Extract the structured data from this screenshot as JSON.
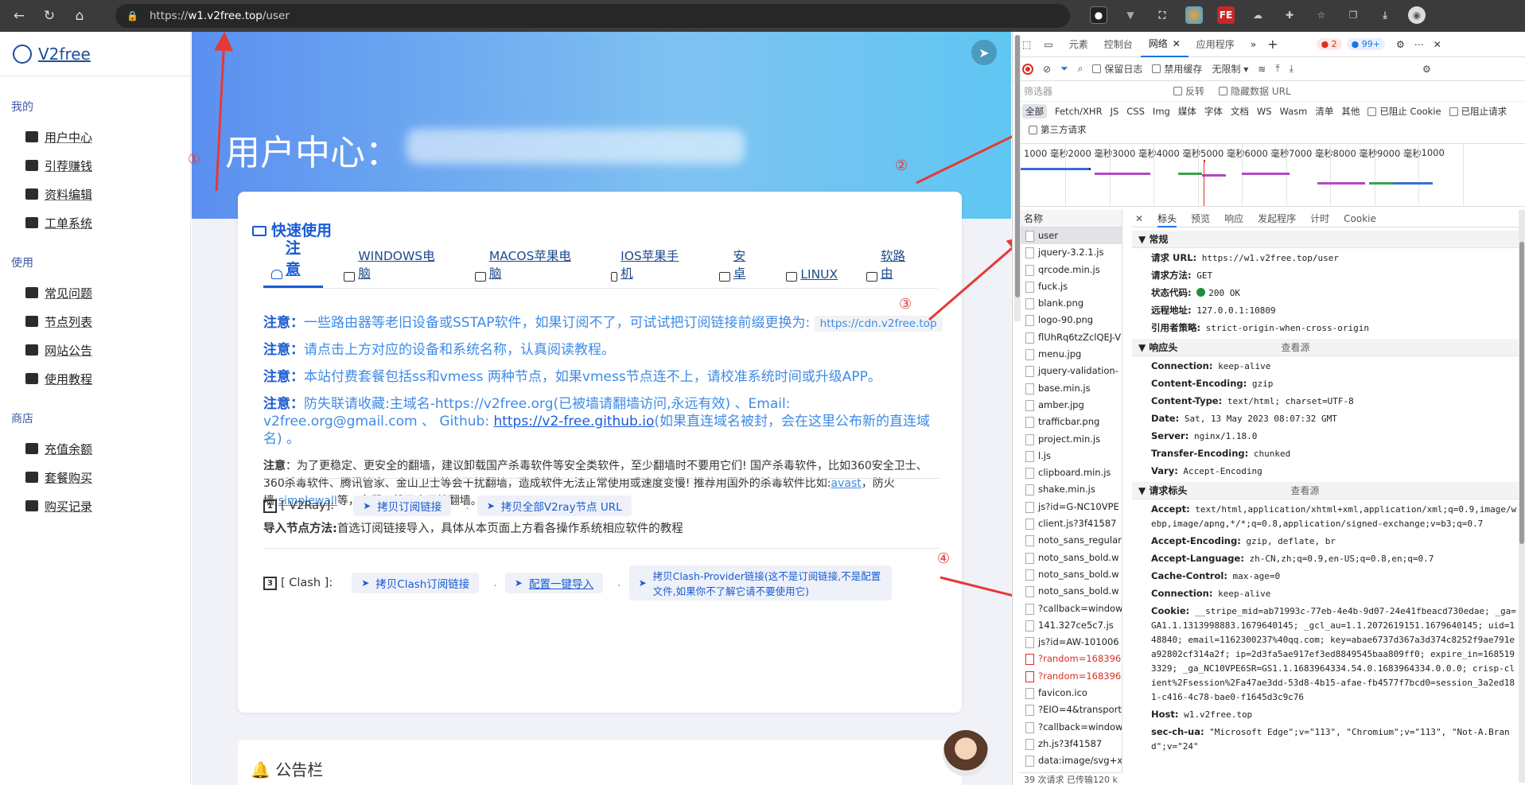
{
  "browser": {
    "url_prefix": "https://",
    "url_host": "w1.v2free.top",
    "url_path": "/user",
    "back_icon": "arrow-left-icon",
    "refresh_icon": "refresh-icon",
    "home_icon": "home-icon"
  },
  "sidebar": {
    "brand": "V2free",
    "sections": [
      {
        "title": "我的",
        "items": [
          "用户中心",
          "引荐赚钱",
          "资料编辑",
          "工单系统"
        ]
      },
      {
        "title": "使用",
        "items": [
          "常见问题",
          "节点列表",
          "网站公告",
          "使用教程"
        ]
      },
      {
        "title": "商店",
        "items": [
          "充值余额",
          "套餐购买",
          "购买记录"
        ]
      }
    ]
  },
  "hero": {
    "title": "用户中心："
  },
  "quick": {
    "title": "快速使用",
    "tabs": [
      "注意",
      "WINDOWS电脑",
      "MACOS苹果电脑",
      "IOS苹果手机",
      "安卓",
      "LINUX",
      "软路由"
    ],
    "note1_label": "注意：",
    "note1_text": "一些路由器等老旧设备或SSTAP软件，如果订阅不了，可试试把订阅链接前缀更换为:",
    "note1_chip": "https://cdn.v2free.top",
    "note2_label": "注意：",
    "note2_text": "请点击上方对应的设备和系统名称，认真阅读教程。",
    "note3_label": "注意：",
    "note3_text": "本站付费套餐包括ss和vmess 两种节点，如果vmess节点连不上，请校准系统时间或升级APP。",
    "note4_label": "注意：",
    "note4_text": "防失联请收藏:主域名-https://v2free.org(已被墙请翻墙访问,永远有效) 、Email: v2free.org@gmail.com 、 Github: ",
    "note4_link": "https://v2-free.github.io",
    "note4_tail": "(如果直连域名被封，会在这里公布新的直连域名) 。",
    "note5_label": "注意",
    "note5_text": "：为了更稳定、更安全的翻墙，建议卸载国产杀毒软件等安全类软件，至少翻墙时不要用它们! 国产杀毒软件，比如360安全卫士、360杀毒软件、腾讯管家、金山卫士等会干扰翻墙，造成软件无法正常使用或速度变慢! 推荐用国外的杀毒软件比如:",
    "note5_link1": "avast",
    "note5_mid": "，防火墙:",
    "note5_link2": "simplewall",
    "note5_tail": "等，它们一般不会干扰翻墙。",
    "v2ray_label": "[ V2Ray]:",
    "v2ray_btn1": "拷贝订阅链接",
    "v2ray_btn2": "拷贝全部V2ray节点 URL",
    "import_label": "导入节点方法:",
    "import_text": "首选订阅链接导入，具体从本页面上方看各操作系统相应软件的教程",
    "clash_label": "[ Clash ]:",
    "clash_btn1": "拷贝Clash订阅链接",
    "clash_btn2": "配置一键导入",
    "clash_btn3": "拷贝Clash-Provider链接(这不是订阅链接,不是配置文件,如果你不了解它请不要使用它)",
    "num1": "1",
    "num3": "3",
    "dot": "."
  },
  "notice": {
    "title": "公告栏"
  },
  "annotations": [
    "①",
    "②",
    "③",
    "④"
  ],
  "devtools": {
    "tabs": [
      "元素",
      "控制台",
      "网络",
      "应用程序"
    ],
    "errors": "2",
    "messages": "99+",
    "toolbar": {
      "preserve_log": "保留日志",
      "disable_cache": "禁用缓存",
      "throttle": "无限制"
    },
    "filter": {
      "placeholder": "筛选器",
      "invert": "反转",
      "hide_data": "隐藏数据 URL"
    },
    "types": [
      "全部",
      "Fetch/XHR",
      "JS",
      "CSS",
      "Img",
      "媒体",
      "字体",
      "文档",
      "WS",
      "Wasm",
      "清单",
      "其他"
    ],
    "blocked_cookies": "已阻止 Cookie",
    "blocked_requests": "已阻止请求",
    "third_party": "第三方请求",
    "timeline_labels": [
      "1000 毫秒",
      "2000 毫秒",
      "3000 毫秒",
      "4000 毫秒",
      "5000 毫秒",
      "6000 毫秒",
      "7000 毫秒",
      "8000 毫秒",
      "9000 毫秒",
      "1000"
    ],
    "name_header": "名称",
    "requests": [
      {
        "name": "user",
        "state": "sel"
      },
      {
        "name": "jquery-3.2.1.js",
        "state": ""
      },
      {
        "name": "qrcode.min.js",
        "state": ""
      },
      {
        "name": "fuck.js",
        "state": ""
      },
      {
        "name": "blank.png",
        "state": ""
      },
      {
        "name": "logo-90.png",
        "state": ""
      },
      {
        "name": "flUhRq6tzZclQEJ-V",
        "state": ""
      },
      {
        "name": "menu.jpg",
        "state": ""
      },
      {
        "name": "jquery-validation-",
        "state": ""
      },
      {
        "name": "base.min.js",
        "state": ""
      },
      {
        "name": "amber.jpg",
        "state": ""
      },
      {
        "name": "trafficbar.png",
        "state": ""
      },
      {
        "name": "project.min.js",
        "state": ""
      },
      {
        "name": "l.js",
        "state": ""
      },
      {
        "name": "clipboard.min.js",
        "state": ""
      },
      {
        "name": "shake.min.js",
        "state": ""
      },
      {
        "name": "js?id=G-NC10VPE",
        "state": ""
      },
      {
        "name": "client.js?3f41587",
        "state": ""
      },
      {
        "name": "noto_sans_regular",
        "state": ""
      },
      {
        "name": "noto_sans_bold.w",
        "state": ""
      },
      {
        "name": "noto_sans_bold.w",
        "state": ""
      },
      {
        "name": "noto_sans_bold.w",
        "state": ""
      },
      {
        "name": "?callback=window",
        "state": ""
      },
      {
        "name": "141.327ce5c7.js",
        "state": ""
      },
      {
        "name": "js?id=AW-101006",
        "state": ""
      },
      {
        "name": "?random=168396",
        "state": "err"
      },
      {
        "name": "?random=168396",
        "state": "err"
      },
      {
        "name": "favicon.ico",
        "state": ""
      },
      {
        "name": "?EIO=4&transport",
        "state": ""
      },
      {
        "name": "?callback=window",
        "state": ""
      },
      {
        "name": "zh.js?3f41587",
        "state": ""
      },
      {
        "name": "data:image/svg+x",
        "state": ""
      }
    ],
    "footer": "39 次请求  已传输120 k",
    "detail_tabs": [
      "标头",
      "预览",
      "响应",
      "发起程序",
      "计时",
      "Cookie"
    ],
    "general": {
      "title": "常规",
      "url_k": "请求 URL:",
      "url_v": "https://w1.v2free.top/user",
      "method_k": "请求方法:",
      "method_v": "GET",
      "status_k": "状态代码:",
      "status_v": "200 OK",
      "remote_k": "远程地址:",
      "remote_v": "127.0.0.1:10809",
      "referrer_k": "引用者策略:",
      "referrer_v": "strict-origin-when-cross-origin"
    },
    "resp": {
      "title": "响应头",
      "view_source": "查看源",
      "h": [
        [
          "Connection:",
          "keep-alive"
        ],
        [
          "Content-Encoding:",
          "gzip"
        ],
        [
          "Content-Type:",
          "text/html; charset=UTF-8"
        ],
        [
          "Date:",
          "Sat, 13 May 2023 08:07:32 GMT"
        ],
        [
          "Server:",
          "nginx/1.18.0"
        ],
        [
          "Transfer-Encoding:",
          "chunked"
        ],
        [
          "Vary:",
          "Accept-Encoding"
        ]
      ]
    },
    "req": {
      "title": "请求标头",
      "view_source": "查看源",
      "h": [
        [
          "Accept:",
          "text/html,application/xhtml+xml,application/xml;q=0.9,image/webp,image/apng,*/*;q=0.8,application/signed-exchange;v=b3;q=0.7"
        ],
        [
          "Accept-Encoding:",
          "gzip, deflate, br"
        ],
        [
          "Accept-Language:",
          "zh-CN,zh;q=0.9,en-US;q=0.8,en;q=0.7"
        ],
        [
          "Cache-Control:",
          "max-age=0"
        ],
        [
          "Connection:",
          "keep-alive"
        ],
        [
          "Cookie:",
          "__stripe_mid=ab71993c-77eb-4e4b-9d07-24e41fbeacd730edae; _ga=GA1.1.1313998883.1679640145; _gcl_au=1.1.2072619151.1679640145; uid=148840; email=1162300237%40qq.com; key=abae6737d367a3d374c8252f9ae791ea92802cf314a2f; ip=2d3fa5ae917ef3ed8849545baa809ff0; expire_in=1685193329; _ga_NC10VPE6SR=GS1.1.1683964334.54.0.1683964334.0.0.0; crisp-client%2Fsession%2Fa47ae3dd-53d8-4b15-afae-fb4577f7bcd0=session_3a2ed181-c416-4c78-bae0-f1645d3c9c76"
        ],
        [
          "Host:",
          "w1.v2free.top"
        ],
        [
          "sec-ch-ua:",
          "\"Microsoft Edge\";v=\"113\", \"Chromium\";v=\"113\", \"Not-A.Brand\";v=\"24\""
        ]
      ]
    }
  },
  "colors": {
    "accent": "#1a5bd6",
    "annotation": "#e53935",
    "hero_start": "#5b8ff0",
    "hero_end": "#5fc6f2"
  }
}
